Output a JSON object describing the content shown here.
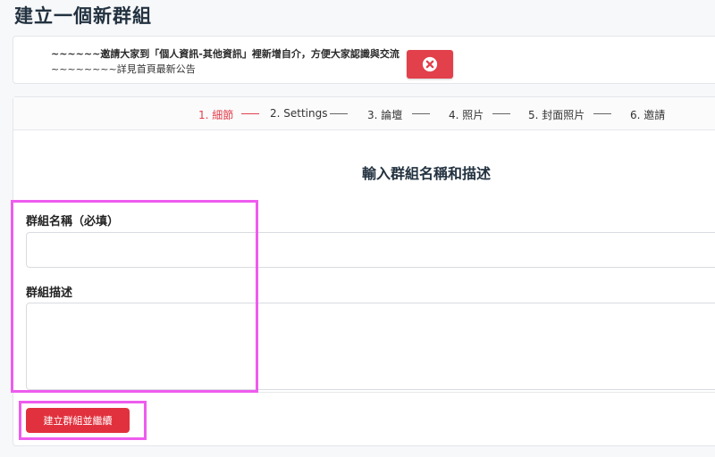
{
  "page": {
    "title": "建立一個新群組"
  },
  "notice": {
    "line1": "~~~~~~邀請大家到「個人資訊-其他資訊」裡新增自介，方便大家認識與交流",
    "line2": "~~~~~~~~詳見首頁最新公告",
    "close_icon": "close-circle-icon"
  },
  "steps": [
    {
      "label": "1. 細節",
      "active": true
    },
    {
      "label": "2. Settings",
      "active": false
    },
    {
      "label": "3. 論壇",
      "active": false
    },
    {
      "label": "4. 照片",
      "active": false
    },
    {
      "label": "5. 封面照片",
      "active": false
    },
    {
      "label": "6. 邀請",
      "active": false
    }
  ],
  "form": {
    "heading": "輸入群組名稱和描述",
    "name_label": "群組名稱（必填）",
    "name_value": "",
    "desc_label": "群組描述",
    "desc_value": "",
    "submit_label": "建立群組並繼續"
  },
  "colors": {
    "accent": "#e2404b",
    "highlight": "#ee5cee",
    "title": "#233240"
  }
}
